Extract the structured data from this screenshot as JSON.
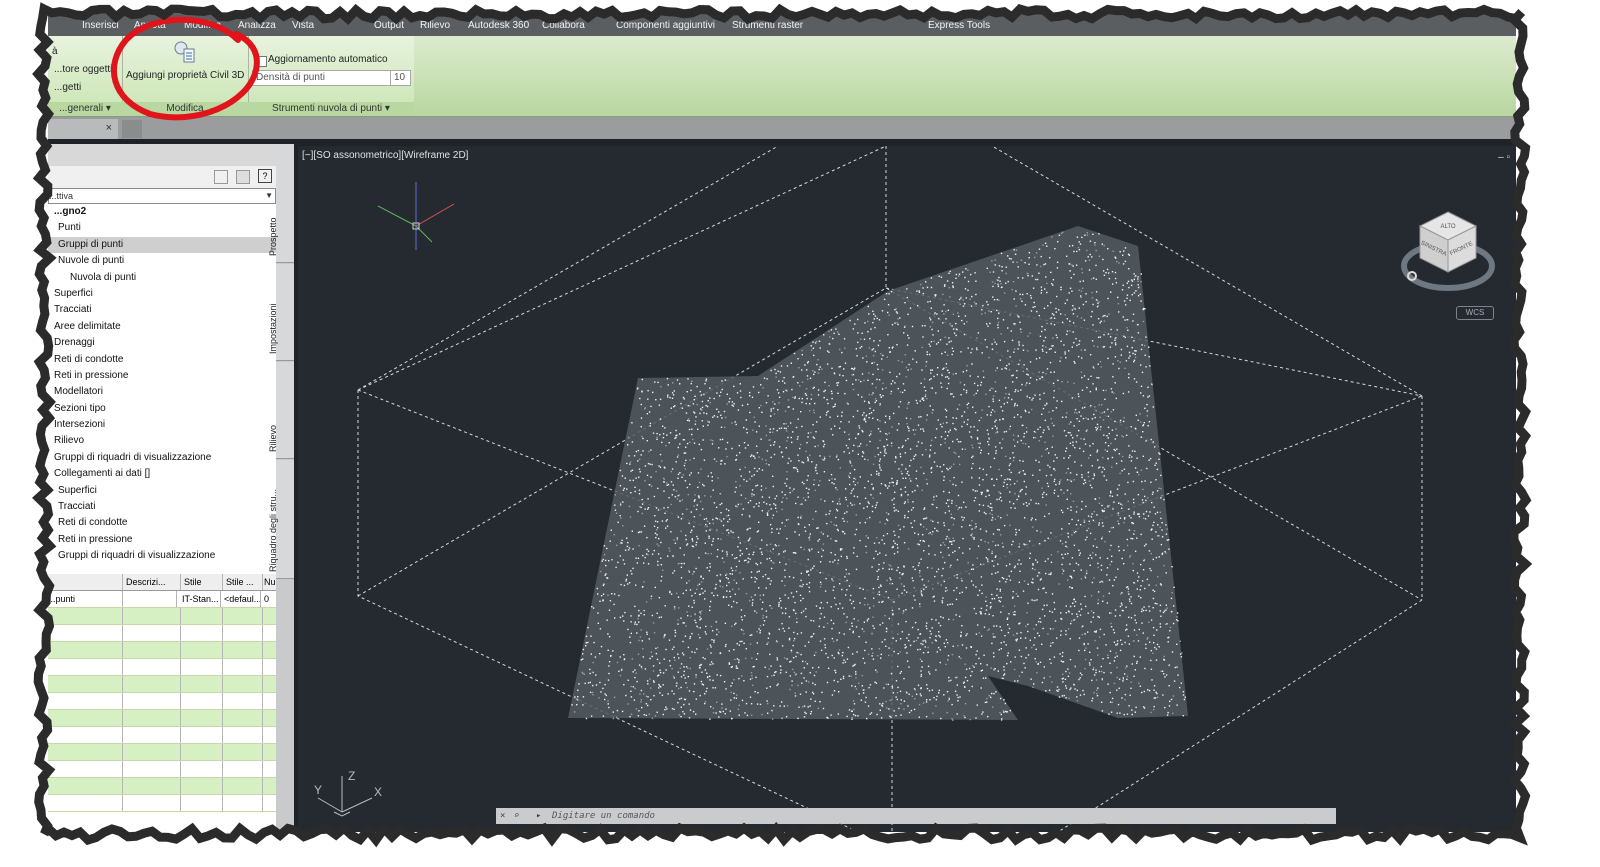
{
  "ribbon": {
    "tabs": [
      "Inserisci",
      "Annota",
      "Modifica",
      "Analizza",
      "Vista",
      "Output",
      "Rilievo",
      "Autodesk 360",
      "Collabora",
      "Componenti aggiuntivi",
      "Strumenti raster",
      "Express Tools"
    ],
    "panel_left": {
      "items": [
        "...tore oggetti",
        "...getti"
      ],
      "footer": "...generali"
    },
    "panel_modifica": {
      "button_label": "Aggiungi proprietà Civil 3D",
      "footer": "Modifica"
    },
    "panel_nuvola": {
      "auto_update_label": "Aggiornamento automatico",
      "density_label": "Densità di punti",
      "density_value": "10",
      "footer": "Strumenti nuvola di punti"
    }
  },
  "palette": {
    "dropdown": "...ttiva",
    "tree": [
      "...gno2",
      "Punti",
      "Gruppi di punti",
      "Nuvole di punti",
      "Nuvola di punti",
      "Superfici",
      "Tracciati",
      "Aree delimitate",
      "Drenaggi",
      "Reti di condotte",
      "Reti in pressione",
      "Modellatori",
      "Sezioni tipo",
      "Intersezioni",
      "Rilievo",
      "Gruppi di riquadri di visualizzazione",
      "Collegamenti ai dati []",
      "Superfici",
      "Tracciati",
      "Reti di condotte",
      "Reti in pressione",
      "Gruppi di riquadri di visualizzazione"
    ],
    "selected_index": 2,
    "grid": {
      "headers": [
        "",
        "Descrizi...",
        "Stile",
        "Stile ...",
        "Nu"
      ],
      "row": [
        "...punti",
        "",
        "IT-Stan...",
        "<defaul...",
        "0"
      ]
    },
    "vertical_tabs": [
      "Prospetto",
      "Impostazioni",
      "Rilievo",
      "Riquadro degli stru..."
    ]
  },
  "viewport": {
    "label": "[−][SO assonometrico][Wireframe 2D]",
    "cube_faces": [
      "ALTO",
      "SINISTRA",
      "FRONTE"
    ],
    "wcs": "WCS",
    "ucs_axes": [
      "Z",
      "Y",
      "X"
    ]
  },
  "command": {
    "placeholder": "Digitare un comando"
  },
  "colors": {
    "ribbon_green": "#c9e5b3",
    "viewport_bg": "#252a30",
    "annotation_red": "#e0141b"
  }
}
